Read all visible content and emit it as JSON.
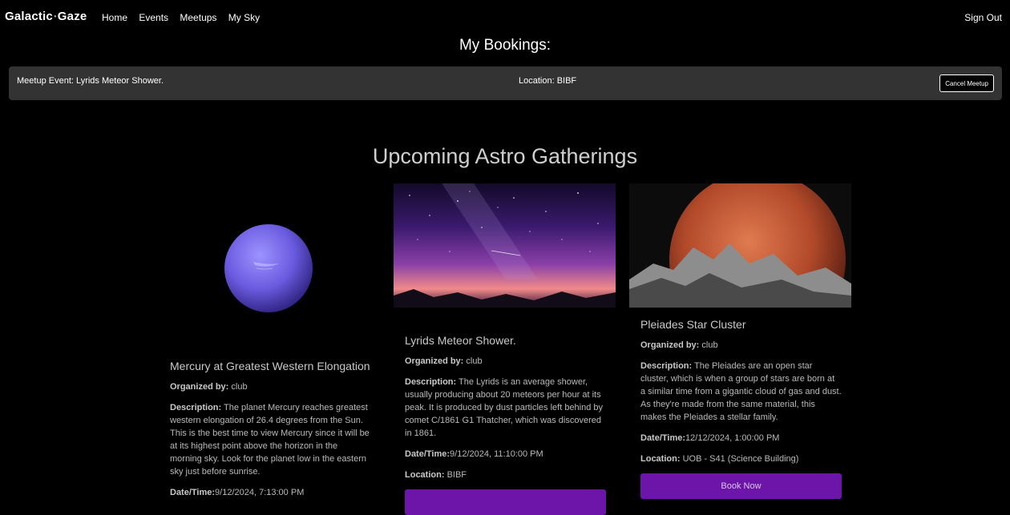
{
  "nav": {
    "brand_part1": "Galactic",
    "brand_part2": "Gaze",
    "links": [
      "Home",
      "Events",
      "Meetups",
      "My Sky"
    ],
    "signout": "Sign Out"
  },
  "bookings": {
    "title": "My Bookings:",
    "items": [
      {
        "event": "Meetup Event: Lyrids Meteor Shower.",
        "location": "Location: BIBF",
        "cancel_label": "Cancel Meetup"
      }
    ]
  },
  "section": {
    "title": "Upcoming Astro Gatherings"
  },
  "labels": {
    "organized_by": "Organized by:",
    "description": "Description:",
    "datetime": "Date/Time:",
    "location": "Location:"
  },
  "cards": [
    {
      "title": "Mercury at Greatest Western Elongation",
      "organizer": "club",
      "description": "The planet Mercury reaches greatest western elongation of 26.4 degrees from the Sun. This is the best time to view Mercury since it will be at its highest point above the horizon in the morning sky. Look for the planet low in the eastern sky just before sunrise.",
      "datetime": "9/12/2024, 7:13:00 PM",
      "location": "",
      "image": "blue-planet"
    },
    {
      "title": "Lyrids Meteor Shower.",
      "organizer": "club",
      "description": "The Lyrids is an average shower, usually producing about 20 meteors per hour at its peak. It is produced by dust particles left behind by comet C/1861 G1 Thatcher, which was discovered in 1861.",
      "datetime": "9/12/2024, 11:10:00 PM",
      "location": "BIBF",
      "image": "meteor-night-sky",
      "button": ""
    },
    {
      "title": "Pleiades Star Cluster",
      "organizer": "club",
      "description": "The Pleiades are an open star cluster, which is when a group of stars are born at a similar time from a gigantic cloud of gas and dust. As they're made from the same material, this makes the Pleiades a stellar family.",
      "datetime": "12/12/2024, 1:00:00 PM",
      "location": "UOB - S41 (Science Building)",
      "image": "red-planet-mountains",
      "button": "Book Now"
    }
  ],
  "colors": {
    "background": "#000000",
    "booking_bar": "#333333",
    "accent_button": "#6d15a9"
  }
}
